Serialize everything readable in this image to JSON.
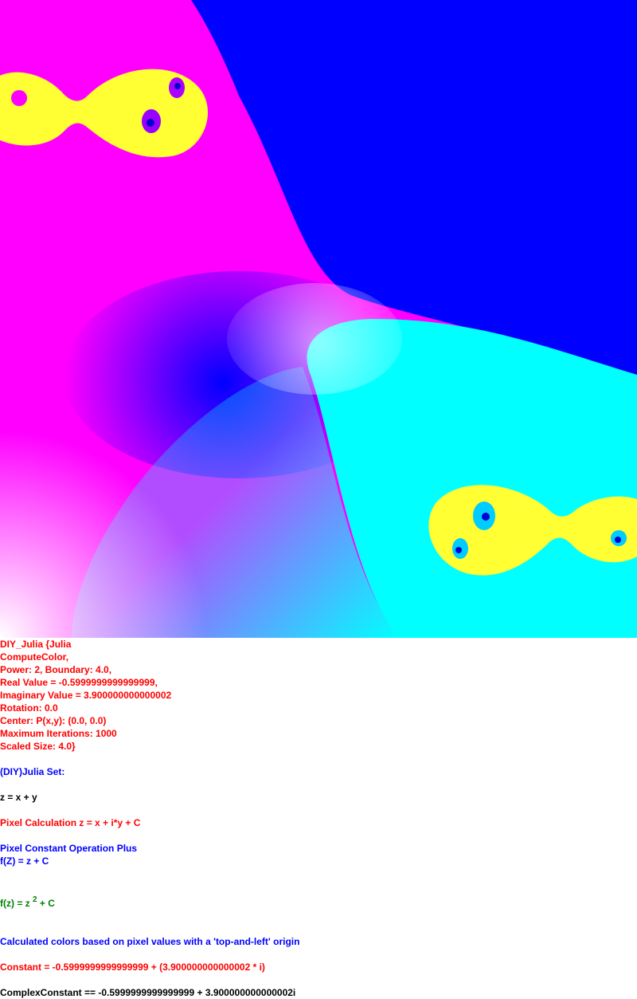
{
  "palette": {
    "magenta": "#ff00ff",
    "blue": "#0000ff",
    "cyan": "#00ffff",
    "yellow": "#ffff33",
    "red_text": "#ff0000",
    "blue_text": "#0000ff",
    "green_text": "#008000",
    "black_text": "#000000"
  },
  "params": {
    "l1": "DIY_Julia {Julia",
    "l2": "ComputeColor,",
    "l3": "Power: 2, Boundary: 4.0,",
    "l4": "Real Value = -0.5999999999999999,",
    "l5": "Imaginary Value = 3.900000000000002",
    "l6": "Rotation: 0.0",
    "l7": "Center: P(x,y): (0.0, 0.0)",
    "l8": "Maximum Iterations: 1000",
    "l9": "Scaled Size: 4.0}"
  },
  "info": {
    "set_name": "(DIY)Julia Set:",
    "z_def": "z = x + y",
    "pixel_calc": "Pixel Calculation z = x + i*y + C",
    "const_op": "Pixel Constant Operation Plus",
    "fz_plus": "f(Z) = z + C",
    "fz_prefix": "f(z) = z",
    "fz_power": "2",
    "fz_suffix": " + C",
    "colors_note": "Calculated colors based on pixel values with a 'top-and-left' origin",
    "constant": "Constant = -0.5999999999999999 + (3.900000000000002 * i)",
    "complex_constant": "ComplexConstant == -0.5999999999999999 + 3.900000000000002i"
  }
}
